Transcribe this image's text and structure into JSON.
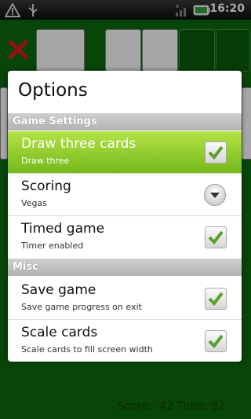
{
  "status_bar": {
    "time": "16:20"
  },
  "game": {
    "score_text": "Score: -42  Time: 92"
  },
  "dialog": {
    "title": "Options",
    "sections": [
      {
        "label": "Game Settings",
        "items": [
          {
            "title": "Draw three cards",
            "subtitle": "Draw three",
            "control": "checkbox",
            "checked": true,
            "selected": true
          },
          {
            "title": "Scoring",
            "subtitle": "Vegas",
            "control": "dropdown"
          },
          {
            "title": "Timed game",
            "subtitle": "Timer enabled",
            "control": "checkbox",
            "checked": true
          }
        ]
      },
      {
        "label": "Misc",
        "items": [
          {
            "title": "Save game",
            "subtitle": "Save game progress on exit",
            "control": "checkbox",
            "checked": true
          },
          {
            "title": "Scale cards",
            "subtitle": "Scale cards to fill screen width",
            "control": "checkbox",
            "checked": true
          }
        ]
      }
    ]
  },
  "colors": {
    "accent": "#8dc63f",
    "checkmark": "#5aa02c",
    "table_green": "#0b6a0e"
  },
  "icons": [
    "warning-icon",
    "usb-icon",
    "signal-icon",
    "battery-icon",
    "close-icon",
    "checkmark-icon",
    "chevron-down-icon"
  ]
}
